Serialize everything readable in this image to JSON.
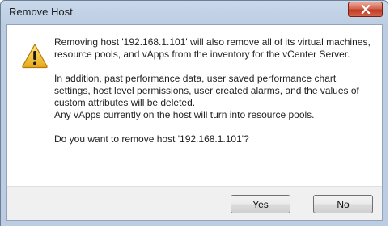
{
  "window": {
    "title": "Remove Host"
  },
  "dialog": {
    "icon": "warning-icon",
    "message_line1": "Removing host '192.168.1.101' will also remove all of its virtual machines, resource pools, and vApps from the inventory for the vCenter Server.",
    "message_line2": "In addition, past performance data, user saved performance chart settings, host level permissions, user created alarms, and the values of custom attributes will be deleted.",
    "message_line3": "Any vApps currently on the host will turn into resource pools.",
    "question": "Do you want to remove host '192.168.1.101'?"
  },
  "buttons": {
    "yes_label": "Yes",
    "no_label": "No"
  },
  "colors": {
    "titlebar": "#bccde3",
    "close_button": "#c13b20",
    "warning": "#f2c232"
  }
}
